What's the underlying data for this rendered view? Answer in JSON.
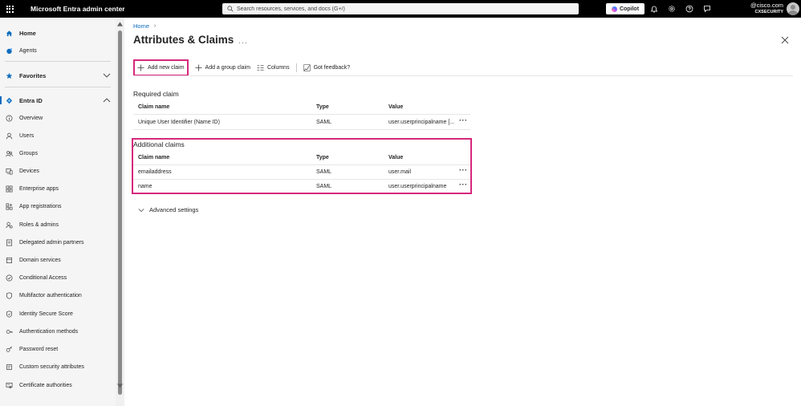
{
  "topbar": {
    "app_title": "Microsoft Entra admin center",
    "search_placeholder": "Search resources, services, and docs (G+/)",
    "copilot_label": "Copilot",
    "account_email": "@cisco.com",
    "account_tenant": "CXSECURITY"
  },
  "sidebar": {
    "items": [
      {
        "label": "Home",
        "icon": "home-icon"
      },
      {
        "label": "Agents",
        "icon": "agents-icon"
      },
      {
        "label": "Favorites",
        "icon": "star-icon"
      },
      {
        "label": "Entra ID",
        "icon": "entra-id-icon"
      },
      {
        "label": "Overview",
        "icon": "info-icon"
      },
      {
        "label": "Users",
        "icon": "user-icon"
      },
      {
        "label": "Groups",
        "icon": "groups-icon"
      },
      {
        "label": "Devices",
        "icon": "devices-icon"
      },
      {
        "label": "Enterprise apps",
        "icon": "apps-icon"
      },
      {
        "label": "App registrations",
        "icon": "app-registrations-icon"
      },
      {
        "label": "Roles & admins",
        "icon": "roles-icon"
      },
      {
        "label": "Delegated admin partners",
        "icon": "partners-icon"
      },
      {
        "label": "Domain services",
        "icon": "domain-icon"
      },
      {
        "label": "Conditional Access",
        "icon": "conditional-access-icon"
      },
      {
        "label": "Multifactor authentication",
        "icon": "mfa-icon"
      },
      {
        "label": "Identity Secure Score",
        "icon": "score-icon"
      },
      {
        "label": "Authentication methods",
        "icon": "auth-methods-icon"
      },
      {
        "label": "Password reset",
        "icon": "password-icon"
      },
      {
        "label": "Custom security attributes",
        "icon": "attributes-icon"
      },
      {
        "label": "Certificate authorities",
        "icon": "certificate-icon"
      }
    ],
    "collapse_label": "«"
  },
  "main": {
    "breadcrumb": "Home",
    "page_title": "Attributes & Claims",
    "toolbar": {
      "add_new_claim": "Add new claim",
      "add_group_claim": "Add a group claim",
      "columns": "Columns",
      "feedback": "Got feedback?"
    },
    "required": {
      "title": "Required claim",
      "headers": [
        "Claim name",
        "Type",
        "Value"
      ],
      "rows": [
        {
          "name": "Unique User Identifier (Name ID)",
          "type": "SAML",
          "value": "user.userprincipalname [..."
        }
      ]
    },
    "additional": {
      "title": "Additional claims",
      "headers": [
        "Claim name",
        "Type",
        "Value"
      ],
      "rows": [
        {
          "name": "emailaddress",
          "type": "SAML",
          "value": "user.mail"
        },
        {
          "name": "name",
          "type": "SAML",
          "value": "user.userprincipalname"
        }
      ]
    },
    "advanced_settings": "Advanced settings"
  },
  "colors": {
    "accent": "#0f6cbd",
    "highlight": "#d6287c",
    "topbar": "#000000"
  }
}
